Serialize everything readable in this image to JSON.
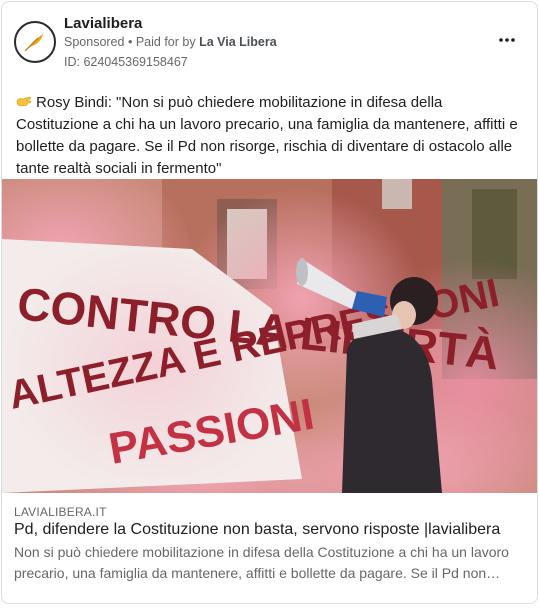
{
  "post": {
    "page_name": "Lavialibera",
    "sponsored_label": "Sponsored",
    "separator": "•",
    "paid_for_label": "Paid for by",
    "payer": "La Via Libera",
    "ad_id": "ID: 624045369158467",
    "more_icon": "more-horizontal-icon",
    "avatar_icon": "feather-logo-icon"
  },
  "body": {
    "emoji": "hand-emoji",
    "text": "Rosy Bindi: \"Non si può chiedere mobilitazione in difesa della Costituzione a chi ha un lavoro precario, una famiglia da mantenere, affitti e bollette da pagare. Se il Pd non risorge, rischia di diventare di ostacolo alle tante realtà sociali in fermento\""
  },
  "image": {
    "banner_lines": [
      "CONTRO LA LIBERTÀ",
      "ALTEZZA E REPRESSIONI",
      "PASSIONI"
    ]
  },
  "link_preview": {
    "domain": "LAVIALIBERA.IT",
    "title": "Pd, difendere la Costituzione non basta, servono risposte |lavialibera",
    "description": "Non si può chiedere mobilitazione in difesa della Costituzione a chi ha un lavoro precario, una famiglia da mantenere, affitti e bollette da pagare. Se il Pd non…"
  },
  "colors": {
    "smoke": "#f2a7b8",
    "text_secondary": "#65676b",
    "border": "#dadde1"
  }
}
